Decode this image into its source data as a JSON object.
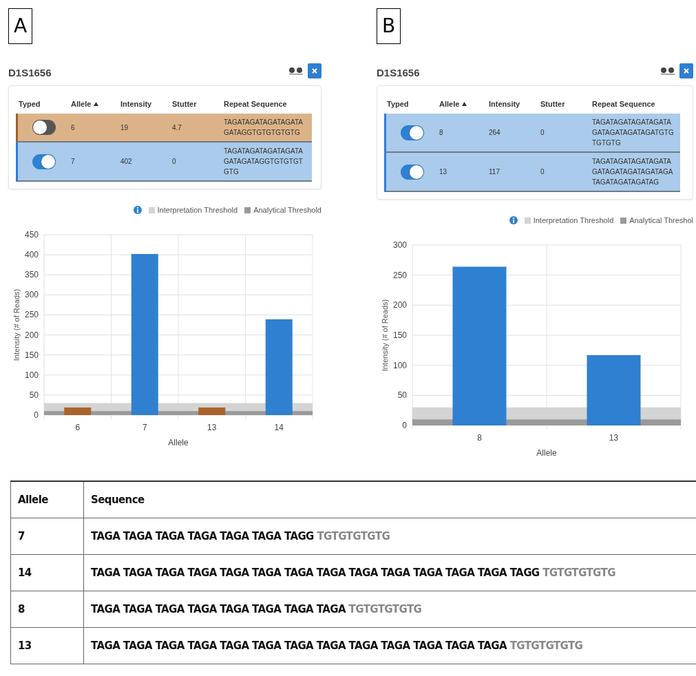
{
  "panels": [
    {
      "label": "A",
      "title": "D1S1656",
      "columns": [
        {
          "label": "Typed",
          "sorted": false
        },
        {
          "label": "Allele",
          "sorted": true
        },
        {
          "label": "Intensity",
          "sorted": false
        },
        {
          "label": "Stutter",
          "sorted": false
        },
        {
          "label": "Repeat Sequence",
          "sorted": false
        }
      ],
      "rows": [
        {
          "typed": false,
          "allele": "6",
          "intensity": "19",
          "stutter": "4.7",
          "sequence": "TAGATAGATAGATAGATAGATAGGTGTGTGTGTG"
        },
        {
          "typed": true,
          "allele": "7",
          "intensity": "402",
          "stutter": "0",
          "sequence": "TAGATAGATAGATAGATAGATAGATAGGTGTGTGTGTG"
        }
      ],
      "legend": [
        {
          "label": "Interpretation Threshold",
          "color": "#d4d4d4"
        },
        {
          "label": "Analytical Threshold",
          "color": "#9a9a9a"
        }
      ],
      "chart_data": {
        "type": "bar",
        "xlabel": "Allele",
        "ylabel": "Intensity (# of Reads)",
        "categories": [
          "6",
          "7",
          "13",
          "14"
        ],
        "series": [
          {
            "color": "#2f80d0",
            "values": [
              null,
              402,
              null,
              239
            ]
          },
          {
            "color": "#a8642a",
            "values": [
              19,
              null,
              19,
              null
            ]
          }
        ],
        "ylim": [
          0,
          450
        ],
        "yticks": [
          0,
          50,
          100,
          150,
          200,
          250,
          300,
          350,
          400,
          450
        ],
        "grid": true,
        "bands": [
          {
            "axis": "y",
            "from": 0,
            "to": 30,
            "color": "#d4d4d4"
          },
          {
            "axis": "y",
            "from": 0,
            "to": 10,
            "color": "#9a9a9a"
          }
        ]
      }
    },
    {
      "label": "B",
      "title": "D1S1656",
      "columns": [
        {
          "label": "Typed",
          "sorted": false
        },
        {
          "label": "Allele",
          "sorted": true
        },
        {
          "label": "Intensity",
          "sorted": false
        },
        {
          "label": "Stutter",
          "sorted": false
        },
        {
          "label": "Repeat Sequence",
          "sorted": false
        }
      ],
      "rows": [
        {
          "typed": true,
          "allele": "8",
          "intensity": "264",
          "stutter": "0",
          "sequence": "TAGATAGATAGATAGATAGATAGATAGATAGATGTGTGTGTG"
        },
        {
          "typed": true,
          "allele": "13",
          "intensity": "117",
          "stutter": "0",
          "sequence": "TAGATAGATAGATAGATAGATAGATAGATAGATAGATAGATAGATAGATAG"
        }
      ],
      "legend": [
        {
          "label": "Interpretation Threshold",
          "color": "#d4d4d4"
        },
        {
          "label": "Analytical Threshol",
          "color": "#9a9a9a"
        }
      ],
      "chart_data": {
        "type": "bar",
        "xlabel": "Allele",
        "ylabel": "Intensity (# of Reads)",
        "categories": [
          "8",
          "13"
        ],
        "series": [
          {
            "color": "#2f80d0",
            "values": [
              264,
              117
            ]
          }
        ],
        "ylim": [
          0,
          300
        ],
        "yticks": [
          0,
          50,
          100,
          150,
          200,
          250,
          300
        ],
        "grid": true,
        "bands": [
          {
            "axis": "y",
            "from": 0,
            "to": 30,
            "color": "#d4d4d4"
          },
          {
            "axis": "y",
            "from": 0,
            "to": 10,
            "color": "#9a9a9a"
          }
        ]
      }
    }
  ],
  "sequence_table": {
    "columns": [
      "Allele",
      "Sequence"
    ],
    "rows": [
      {
        "allele": "7",
        "repeats": "TAGA TAGA TAGA TAGA TAGA TAGA TAGG",
        "tail": "TGTGTGTGTG"
      },
      {
        "allele": "14",
        "repeats": "TAGA TAGA TAGA TAGA TAGA TAGA TAGA TAGA TAGA TAGA TAGA TAGA TAGA TAGG",
        "tail": "TGTGTGTGTG"
      },
      {
        "allele": "8",
        "repeats": "TAGA TAGA TAGA TAGA TAGA TAGA TAGA TAGA",
        "tail": "TGTGTGTGTG"
      },
      {
        "allele": "13",
        "repeats": "TAGA TAGA TAGA TAGA TAGA TAGA TAGA TAGA TAGA TAGA TAGA TAGA TAGA",
        "tail": "TGTGTGTGTG"
      }
    ]
  }
}
